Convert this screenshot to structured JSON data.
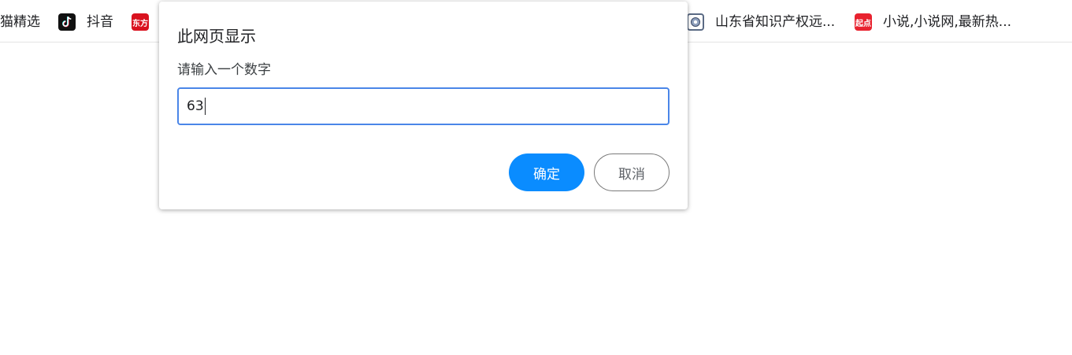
{
  "bookmarks": [
    {
      "label": "猫精选",
      "icon": "none"
    },
    {
      "label": "抖音",
      "icon": "douyin-icon"
    },
    {
      "label": "东方",
      "icon": "dongfang-icon",
      "icon_text": "东方"
    },
    {
      "label": "山东省知识产权远...",
      "icon": "emblem-icon"
    },
    {
      "label": "小说,小说网,最新热...",
      "icon": "qidian-icon",
      "icon_text": "起点"
    }
  ],
  "dialog": {
    "title": "此网页显示",
    "message": "请输入一个数字",
    "input_value": "63",
    "ok_label": "确定",
    "cancel_label": "取消"
  },
  "colors": {
    "ok_button": "#0a8cff",
    "input_focus_border": "#4a86e8"
  }
}
